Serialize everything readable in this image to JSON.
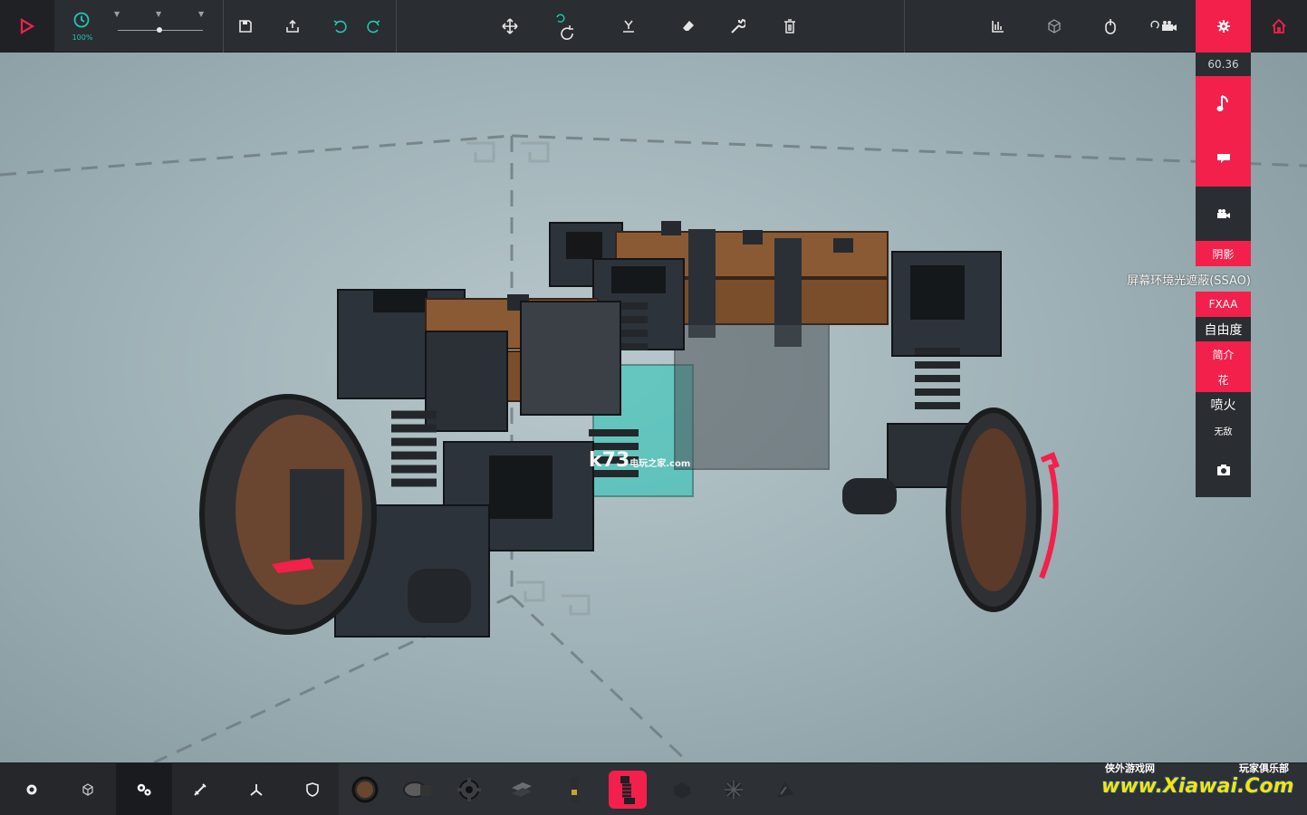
{
  "top_toolbar": {
    "time_label": "100%",
    "tools_left": [
      "play-icon",
      "time-icon",
      "save-icon",
      "load-icon",
      "undo-icon",
      "redo-icon"
    ],
    "tools_center": [
      "move-icon",
      "rotate-icon",
      "drop-icon",
      "eraser-icon",
      "wrench-icon",
      "trash-icon"
    ],
    "tools_right": [
      "stats-icon",
      "cube-icon",
      "mouse-icon",
      "camera-swap-icon",
      "settings-icon",
      "home-icon"
    ]
  },
  "right_panel": {
    "fps": "60.36",
    "options": {
      "shadow": "阴影",
      "ssao": "屏幕环境光遮蔽(SSAO)",
      "fxaa": "FXAA",
      "freedom": "自由度",
      "intro": "简介",
      "flower": "花",
      "flame": "喷火",
      "invincible": "无敌"
    }
  },
  "watermark": {
    "brand": "k73",
    "brand_sub": "电玩之家",
    "brand_domain": ".com"
  },
  "xiawai": {
    "left": "侠外游戏网",
    "right": "玩家俱乐部",
    "main": "www.Xiawai.Com"
  },
  "colors": {
    "accent": "#f2204b",
    "toolbar": "#2a2d31",
    "teal": "#22c7b7"
  }
}
